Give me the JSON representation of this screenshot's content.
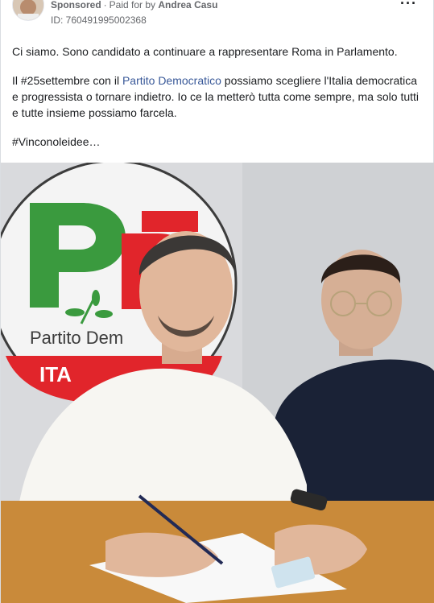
{
  "post": {
    "sponsored_label": "Sponsored",
    "paid_for_prefix": "Paid for by",
    "payer": "Andrea Casu",
    "id_line": "ID: 760491995002368",
    "more_icon": "more-horizontal-icon",
    "text": {
      "line1": "Ci siamo. Sono candidato a continuare a rappresentare Roma in Parlamento.",
      "p2_before": "Il #25settembre con il ",
      "p2_link": "Partito Democratico",
      "p2_after": " possiamo scegliere l'Italia democratica e progressista o tornare indietro. Io ce la metterò tutta come sempre, ma solo tutti e tutte insieme possiamo farcela.",
      "hashtag": "#Vinconoleidee…"
    },
    "image": {
      "logo_text": "Partito Dem",
      "logo_text_bottom": "ITA"
    }
  },
  "colors": {
    "link": "#385898",
    "pd_green": "#3a9a3e",
    "pd_red": "#e1252b",
    "text": "#1c1e21",
    "muted": "#65676b"
  }
}
